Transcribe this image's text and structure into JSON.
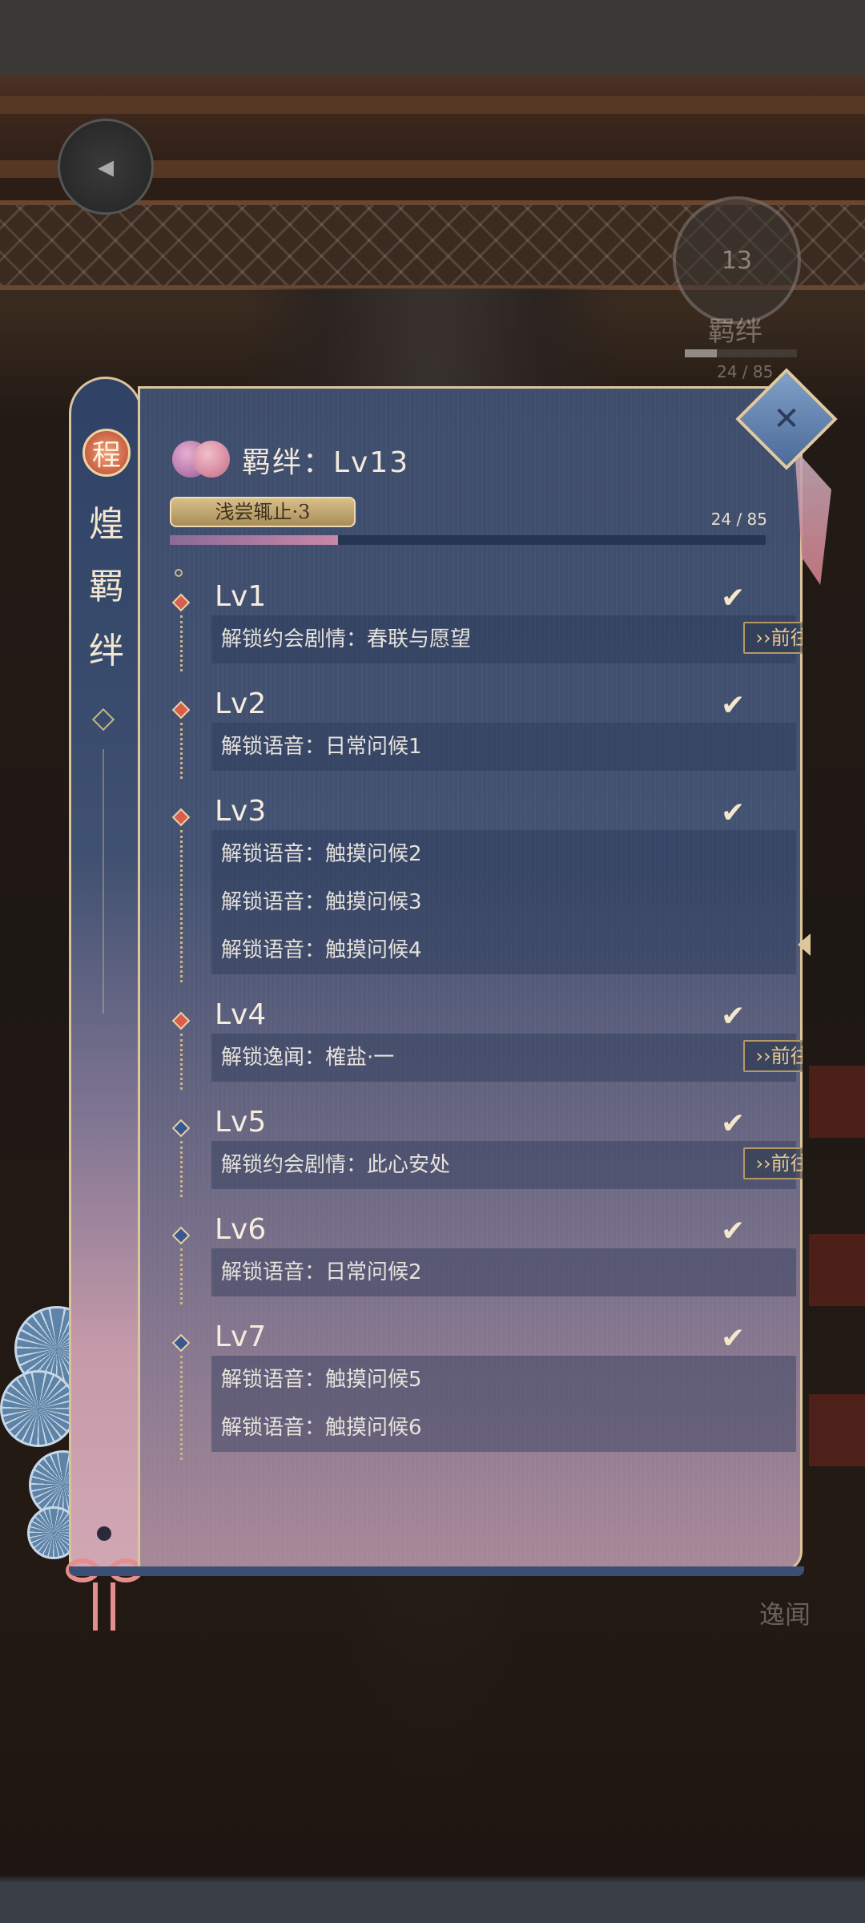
{
  "background": {
    "bond_badge": {
      "level": "13",
      "label": "羁绊",
      "count": "24 / 85"
    },
    "side_label": "逸闻"
  },
  "side_tab": {
    "emblem": "程",
    "chars": [
      "煌",
      "羁",
      "绊"
    ]
  },
  "panel": {
    "title": "羁绊：Lv13",
    "stage_badge": "浅尝辄止·3",
    "progress": {
      "current": 24,
      "total": 85,
      "text": "24 / 85",
      "fraction": 0.282
    },
    "levels": [
      {
        "label": "Lv1",
        "checked": true,
        "rows": [
          {
            "text": "解锁约会剧情：春联与愿望",
            "button": "››前往约会"
          }
        ]
      },
      {
        "label": "Lv2",
        "checked": true,
        "rows": [
          {
            "text": "解锁语音：日常问候1"
          }
        ]
      },
      {
        "label": "Lv3",
        "checked": true,
        "rows": [
          {
            "text": "解锁语音：触摸问候2"
          },
          {
            "text": "解锁语音：触摸问候3"
          },
          {
            "text": "解锁语音：触摸问候4"
          }
        ]
      },
      {
        "label": "Lv4",
        "checked": true,
        "rows": [
          {
            "text": "解锁逸闻：榷盐·一",
            "button": "››前往查看"
          }
        ]
      },
      {
        "label": "Lv5",
        "checked": true,
        "rows": [
          {
            "text": "解锁约会剧情：此心安处",
            "button": "››前往约会"
          }
        ]
      },
      {
        "label": "Lv6",
        "checked": true,
        "rows": [
          {
            "text": "解锁语音：日常问候2"
          }
        ]
      },
      {
        "label": "Lv7",
        "checked": true,
        "rows": [
          {
            "text": "解锁语音：触摸问候5"
          },
          {
            "text": "解锁语音：触摸问候6"
          }
        ]
      }
    ],
    "check_glyph": "✔"
  },
  "icons": {
    "back": "back-arrow-icon",
    "close": "close-diamond-icon",
    "hearts": "double-heart-icon"
  },
  "colors": {
    "accent_gold": "#dcc69b",
    "progress_fill": "#c888a8",
    "button_text": "#e9c98e"
  }
}
